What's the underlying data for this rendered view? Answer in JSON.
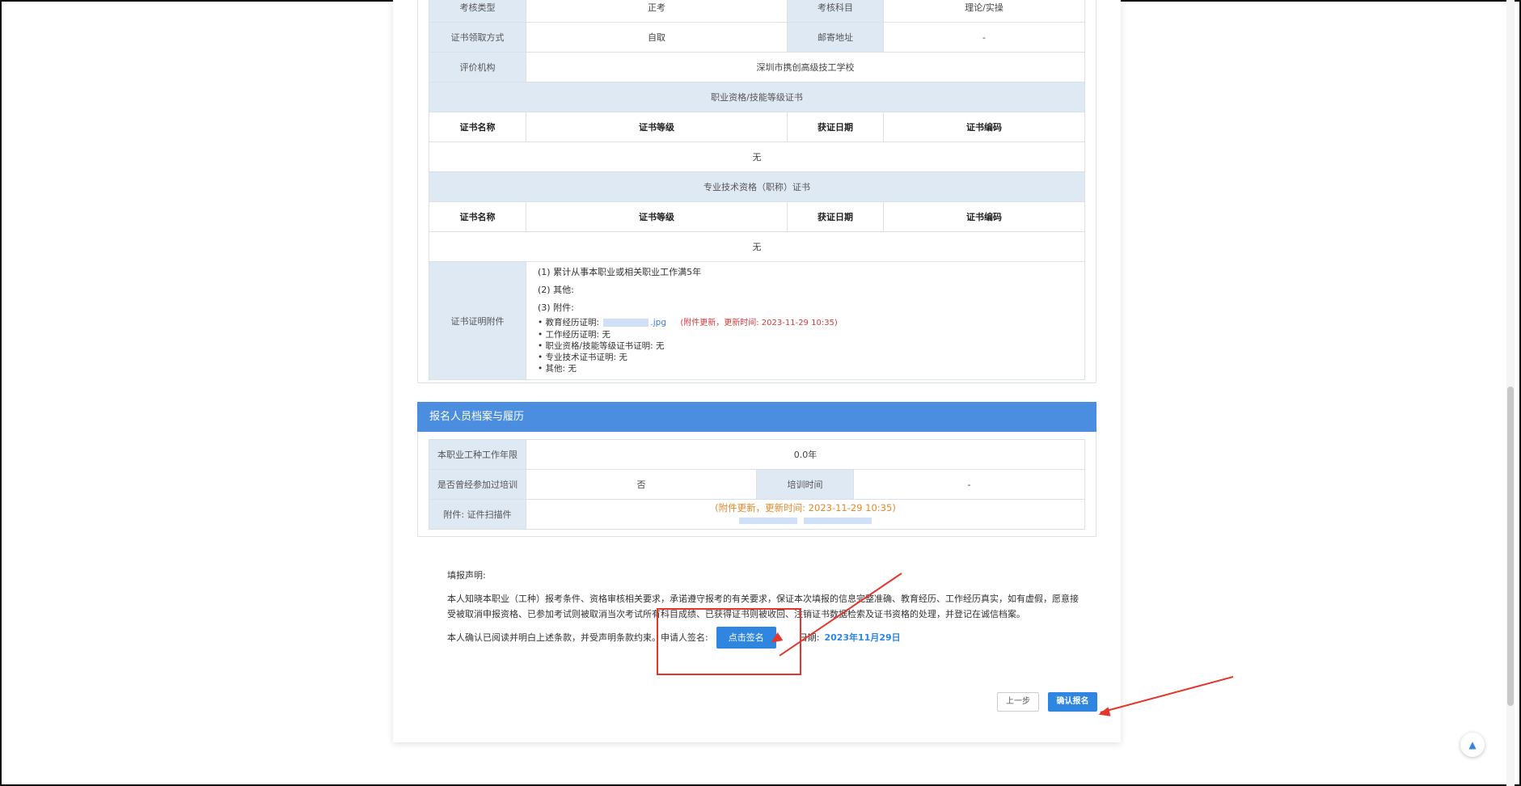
{
  "top_table": {
    "rows": [
      {
        "label1": "考核类型",
        "value1": "正考",
        "label2": "考核科目",
        "value2": "理论/实操"
      },
      {
        "label1": "证书领取方式",
        "value1": "自取",
        "label2": "邮寄地址",
        "value2": "-"
      }
    ],
    "org_label": "评价机构",
    "org_value": "深圳市携创高级技工学校",
    "section1_title": "职业资格/技能等级证书",
    "section2_title": "专业技术资格（职称）证书",
    "cert_headers": [
      "证书名称",
      "证书等级",
      "获证日期",
      "证书编码"
    ],
    "none_text": "无",
    "attach_label": "证书证明附件",
    "attach_lines": [
      "(1) 累计从事本职业或相关职业工作满5年",
      "(2) 其他:",
      "(3) 附件:"
    ],
    "attach_items": [
      {
        "label": "教育经历证明:",
        "value": ".jpg",
        "update": "(附件更新，更新时间: 2023-11-29 10:35)"
      },
      {
        "label": "工作经历证明:",
        "value": "无"
      },
      {
        "label": "职业资格/技能等级证书证明:",
        "value": "无"
      },
      {
        "label": "专业技术证书证明:",
        "value": "无"
      },
      {
        "label": "其他:",
        "value": "无"
      }
    ]
  },
  "profile": {
    "title": "报名人员档案与履历",
    "years_label": "本职业工种工作年限",
    "years_value": "0.0年",
    "training_label": "是否曾经参加过培训",
    "training_value": "否",
    "training_time_label": "培训时间",
    "training_time_value": "-",
    "scan_label": "附件: 证件扫描件",
    "scan_update": "(附件更新，更新时间: 2023-11-29 10:35)"
  },
  "declaration": {
    "title": "填报声明:",
    "body": "本人知晓本职业（工种）报考条件、资格审核相关要求，承诺遵守报考的有关要求，保证本次填报的信息完整准确、教育经历、工作经历真实，如有虚假，愿意接受被取消申报资格、已参加考试则被取消当次考试所有科目成绩、已获得证书则被收回、注销证书数据检索及证书资格的处理，并登记在诚信档案。",
    "confirm_text": "本人确认已阅读并明白上述条款，并受声明条款约束。申请人签名:",
    "sign_button": "点击签名",
    "date_label": "日期:",
    "date_value": "2023年11月29日"
  },
  "actions": {
    "prev_label": "上一步",
    "confirm_label": "确认报名"
  },
  "colors": {
    "accent": "#2f86e0",
    "header_blue": "#4b8ee0",
    "label_bg": "#dfe9f4",
    "annotation_red": "#e4362c"
  },
  "icons": {
    "back_to_top": "arrow-up-icon"
  }
}
